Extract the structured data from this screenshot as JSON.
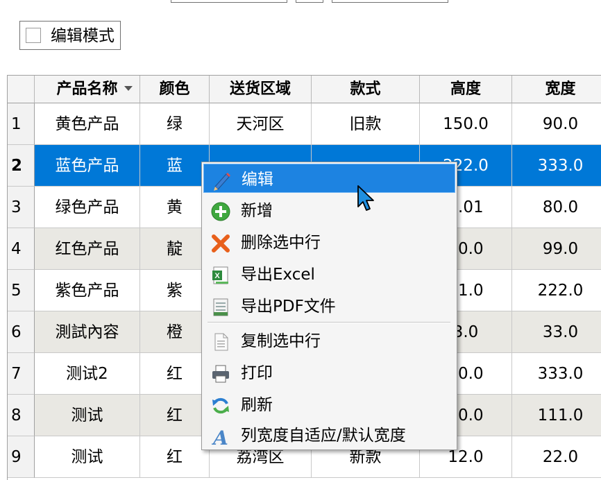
{
  "edit_mode": {
    "label": "编辑模式",
    "checked": false
  },
  "grid": {
    "columns": [
      {
        "label": ""
      },
      {
        "label": "产品名称",
        "sorted": "desc"
      },
      {
        "label": "颜色"
      },
      {
        "label": "送货区域"
      },
      {
        "label": "款式"
      },
      {
        "label": "高度"
      },
      {
        "label": "宽度"
      }
    ],
    "rows": [
      {
        "num": "1",
        "name": "黄色产品",
        "color": "绿",
        "area": "天河区",
        "style": "旧款",
        "height": "150.0",
        "width": "90.0"
      },
      {
        "num": "2",
        "name": "蓝色产品",
        "color": "蓝",
        "area": "",
        "style": "",
        "height": "222.0",
        "width": "333.0",
        "selected": true
      },
      {
        "num": "3",
        "name": "绿色产品",
        "color": "黄",
        "area": "",
        "style": "",
        "height": "0.01",
        "width": "80.0"
      },
      {
        "num": "4",
        "name": "红色产品",
        "color": "靛",
        "area": "",
        "style": "",
        "height": "30.0",
        "width": "99.0"
      },
      {
        "num": "5",
        "name": "紫色产品",
        "color": "紫",
        "area": "",
        "style": "",
        "height": "11.0",
        "width": "222.0"
      },
      {
        "num": "6",
        "name": "測試內容",
        "color": "橙",
        "area": "",
        "style": "",
        "height": "3.0",
        "width": "33.0"
      },
      {
        "num": "7",
        "name": "测试2",
        "color": "红",
        "area": "",
        "style": "",
        "height": "00.0",
        "width": "333.0"
      },
      {
        "num": "8",
        "name": "测试",
        "color": "红",
        "area": "",
        "style": "",
        "height": "20.0",
        "width": "111.0"
      },
      {
        "num": "9",
        "name": "测试",
        "color": "红",
        "area": "荔湾区",
        "style": "新款",
        "height": "12.0",
        "width": "22.0"
      }
    ]
  },
  "context_menu": {
    "items": [
      {
        "label": "编辑",
        "icon": "pencil-icon"
      },
      {
        "label": "新增",
        "icon": "add-icon"
      },
      {
        "label": "删除选中行",
        "icon": "delete-icon"
      },
      {
        "label": "导出Excel",
        "icon": "excel-icon"
      },
      {
        "label": "导出PDF文件",
        "icon": "pdf-icon"
      },
      {
        "label": "复制选中行",
        "icon": "copy-icon"
      },
      {
        "label": "打印",
        "icon": "print-icon"
      },
      {
        "label": "刷新",
        "icon": "refresh-icon"
      },
      {
        "label": "列宽度自适应/默认宽度",
        "icon": "font-icon"
      }
    ]
  },
  "colors": {
    "selection": "#0078d7",
    "menu_highlight": "#1d83e1",
    "alt_row": "#e9e8e3"
  }
}
